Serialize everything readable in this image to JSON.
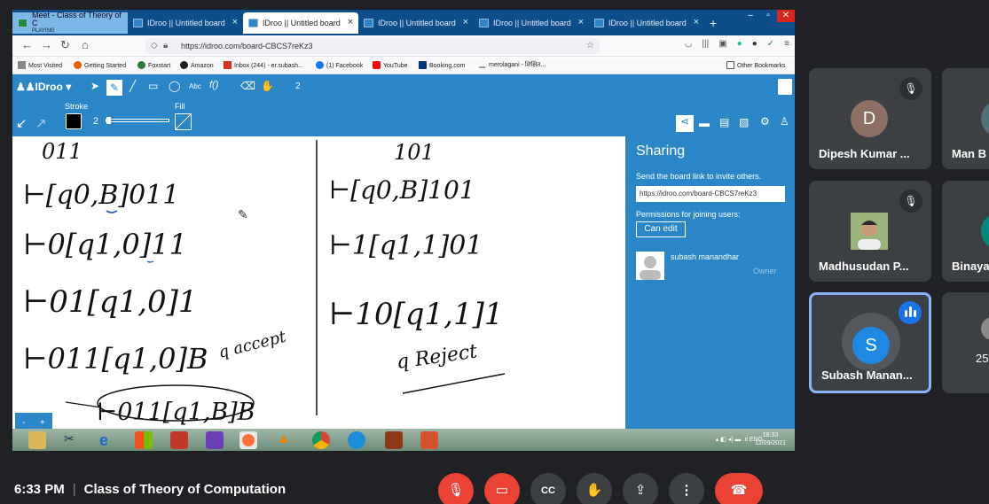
{
  "browser": {
    "tabs": [
      {
        "label": "Meet - Class of Theory of C",
        "sub": "PLAYING"
      },
      {
        "label": "IDroo || Untitled board"
      },
      {
        "label": "IDroo || Untitled board"
      },
      {
        "label": "IDroo || Untitled board"
      },
      {
        "label": "IDroo || Untitled board"
      },
      {
        "label": "IDroo || Untitled board"
      }
    ],
    "url": "https://idroo.com/board-CBCS7reKz3",
    "bookmarks": [
      "Most Visited",
      "Getting Started",
      "Foxstart",
      "Amazon",
      "Inbox (244) - er.subash...",
      "(1) Facebook",
      "YouTube",
      "Booking.com",
      "merolagani - शिक्षित...",
      "Other Bookmarks"
    ]
  },
  "idroo": {
    "logo": "IDroo",
    "tool_text": "Abc",
    "tool_func": "f()",
    "page": "2",
    "stroke_label": "Stroke",
    "fill_label": "Fill",
    "stroke_width": "2",
    "stroke_color": "#000000",
    "accent": "#2b86c7"
  },
  "board": {
    "left": [
      "011",
      "⊢[q0,B]011",
      "⊢0[q1,0]11",
      "⊢01[q1,0]1",
      "⊢011[q1,0]B",
      "q accept",
      "⊢011[q1,B]B"
    ],
    "right": [
      "101",
      "⊢[q0,B]101",
      "⊢1[q1,1]01",
      "⊢10[q1,1]1",
      "q Reject"
    ]
  },
  "sharing": {
    "title": "Sharing",
    "desc": "Send the board link to invite others.",
    "link": "https://idroo.com/board-CBCS7reKz3",
    "perm_label": "Permissions for joining users:",
    "can_edit": "Can edit",
    "user": "subash manandhar",
    "role": "Owner"
  },
  "taskbar": {
    "lang": "ENG",
    "time": "18:33",
    "date": "12/09/2021"
  },
  "participants": [
    {
      "name": "Dipesh Kumar ...",
      "initial": "D",
      "color": "#8d6e63",
      "muted": true
    },
    {
      "name": "Man B",
      "initial": "",
      "color": "#546e7a",
      "muted": true
    },
    {
      "name": "Madhusudan P...",
      "initial": "",
      "color": "#6d8a5a",
      "muted": true
    },
    {
      "name": "Binaya",
      "initial": "",
      "color": "#00897b",
      "muted": false
    },
    {
      "name": "Subash Manan...",
      "initial": "S",
      "color": "#1e88e5",
      "muted": false,
      "speaking": true
    },
    {
      "name": "25",
      "initial": "",
      "color": "#8a8a8a",
      "muted": false
    }
  ],
  "meeting": {
    "time": "6:33 PM",
    "title": "Class of Theory of Computation"
  }
}
